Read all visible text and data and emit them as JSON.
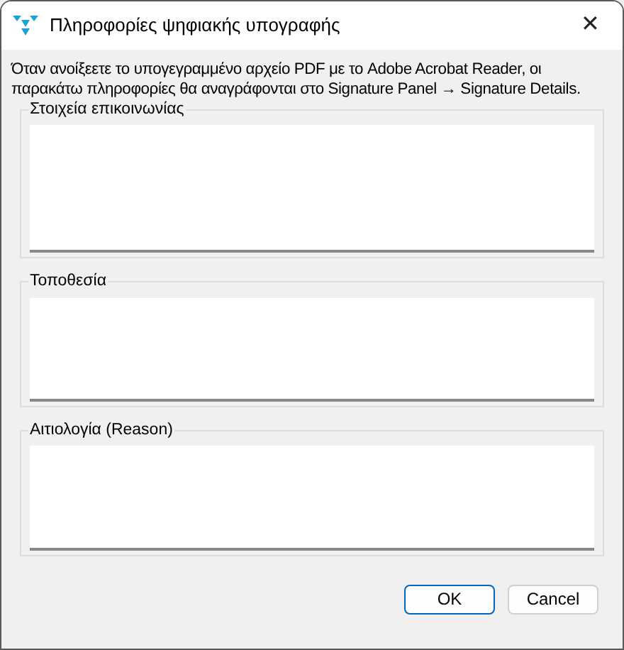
{
  "window": {
    "title": "Πληροφορίες ψηφιακής υπογραφής",
    "close": "✕"
  },
  "intro": "Όταν ανοίξεετε το υπογεγραμμένο αρχείο PDF με το Adobe Acrobat Reader, οι παρακάτω πληροφορίες θα αναγράφονται στο Signature Panel → Signature Details.",
  "groups": [
    {
      "label": "Στοιχεία επικοινωνίας"
    },
    {
      "label": "Τοποθεσία"
    },
    {
      "label": "Αιτιολογία (Reason)"
    }
  ],
  "buttons": [
    {
      "label": "OK",
      "default": true
    },
    {
      "label": "Cancel",
      "default": false
    }
  ]
}
